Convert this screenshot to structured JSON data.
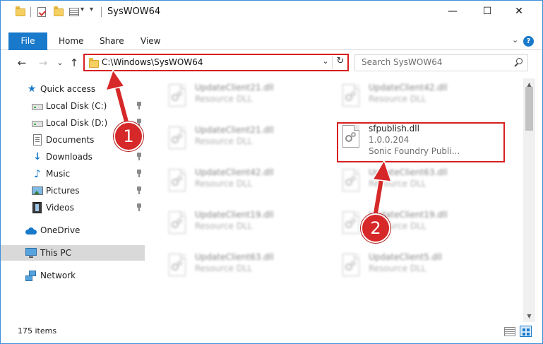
{
  "window": {
    "title": "SysWOW64",
    "controls": {
      "minimize": "—",
      "maximize": "☐",
      "close": "✕"
    }
  },
  "quick_access_toolbar": {
    "dropdown_glyph": "▾",
    "customize_glyph": "▾"
  },
  "ribbon": {
    "file_tab": "File",
    "tabs": [
      "Home",
      "Share",
      "View"
    ],
    "expand_glyph": "⌄",
    "help_label": "?"
  },
  "navigation": {
    "back_glyph": "←",
    "forward_glyph": "→",
    "recent_glyph": "⌄",
    "up_glyph": "↑",
    "address": "C:\\Windows\\SysWOW64",
    "address_dropdown_glyph": "⌄",
    "refresh_glyph": "↻",
    "search_placeholder": "Search SysWOW64"
  },
  "sidebar": {
    "quick_access": "Quick access",
    "items": [
      {
        "label": "Local Disk (C:)",
        "icon": "drive-icon",
        "pinned": true
      },
      {
        "label": "Local Disk (D:)",
        "icon": "drive-icon",
        "pinned": true
      },
      {
        "label": "Documents",
        "icon": "documents-icon",
        "pinned": true
      },
      {
        "label": "Downloads",
        "icon": "downloads-icon",
        "pinned": true
      },
      {
        "label": "Music",
        "icon": "music-icon",
        "pinned": true
      },
      {
        "label": "Pictures",
        "icon": "pictures-icon",
        "pinned": true
      },
      {
        "label": "Videos",
        "icon": "videos-icon",
        "pinned": true
      }
    ],
    "onedrive": "OneDrive",
    "this_pc": "This PC",
    "network": "Network",
    "selected": "This PC"
  },
  "files": {
    "left_column": [
      {
        "name": "UpdateClient21.dll",
        "type": "Resource DLL"
      },
      {
        "name": "UpdateClient21.dll",
        "type": "Resource DLL"
      },
      {
        "name": "UpdateClient42.dll",
        "type": "Resource DLL"
      },
      {
        "name": "UpdateClient19.dll",
        "type": "Resource DLL"
      },
      {
        "name": "UpdateClient63.dll",
        "type": "Resource DLL"
      }
    ],
    "right_column": [
      {
        "name": "UpdateClient42.dll",
        "type": "Resource DLL"
      },
      {
        "name": "UpdateClient63.dll",
        "type": "Resource DLL"
      },
      {
        "name": "UpdateClient19.dll",
        "type": "Resource DLL"
      },
      {
        "name": "UpdateClient5.dll",
        "type": "Resource DLL"
      }
    ],
    "highlighted": {
      "name": "sfpublish.dll",
      "version": "1.0.0.204",
      "company": "Sonic Foundry Publi..."
    }
  },
  "scrollbar": {
    "up_glyph": "▲",
    "down_glyph": "▼"
  },
  "status": {
    "item_count": "175 items"
  },
  "annotations": {
    "step1": "1",
    "step2": "2",
    "color": "#d62828"
  }
}
